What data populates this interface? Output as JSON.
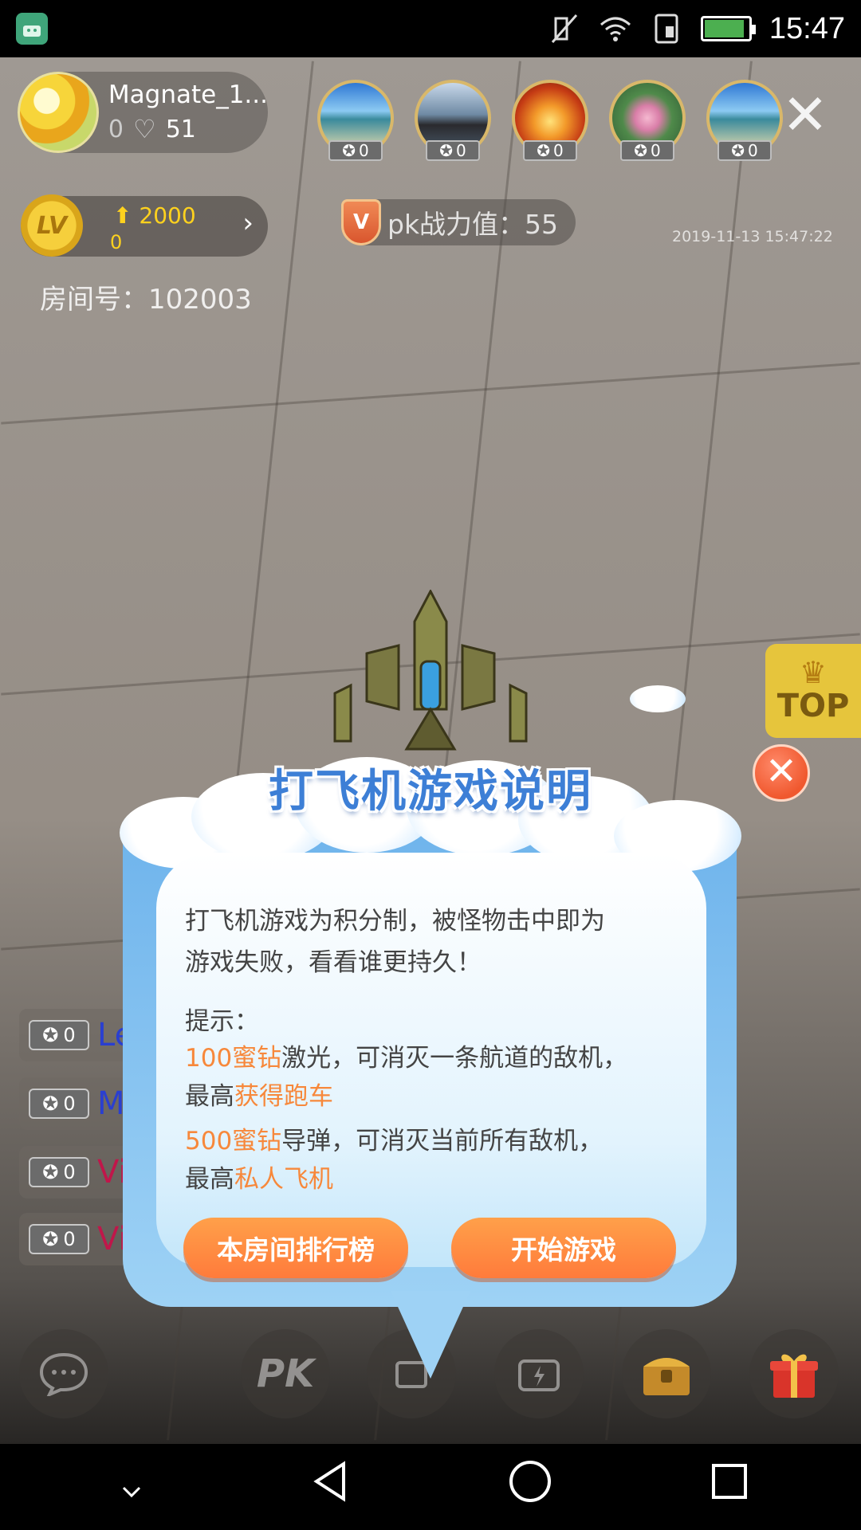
{
  "status_bar": {
    "time": "15:47",
    "battery_level": 0.85,
    "icons": [
      "android-icon",
      "mute-icon",
      "wifi-icon",
      "sim-icon",
      "battery-icon"
    ]
  },
  "host": {
    "name": "Magnate_1...",
    "hearts": "0",
    "fans": "51"
  },
  "viewers": [
    {
      "stars": "0"
    },
    {
      "stars": "0"
    },
    {
      "stars": "0"
    },
    {
      "stars": "0"
    },
    {
      "stars": "0"
    }
  ],
  "close_symbol": "✕",
  "level": {
    "badge": "LV",
    "up_value": "2000",
    "current": "0",
    "arrow": "›"
  },
  "pk": {
    "label": "pk战力值：55",
    "shield_letter": "V"
  },
  "timestamp": "2019-11-13 15:47:22",
  "room_number": "房间号：102003",
  "top_button": {
    "label": "TOP"
  },
  "chat_list": [
    {
      "stars": "0",
      "name": "Le",
      "color": "#2a3fd0"
    },
    {
      "stars": "0",
      "name": "M",
      "color": "#2a3fd0"
    },
    {
      "stars": "0",
      "name": "Vi",
      "color": "#c0164a"
    },
    {
      "stars": "0",
      "name": "Vi",
      "color": "#c0164a"
    }
  ],
  "toolbar": {
    "pk_label": "PK"
  },
  "dialog": {
    "title": "打飞机游戏说明",
    "close": "✕",
    "line1": "打飞机游戏为积分制，被怪物击中即为",
    "line2": "游戏失败，看看谁更持久！",
    "tip_label": "提示：",
    "tip1_hl": "100蜜钻",
    "tip1_rest": "激光，可消灭一条航道的敌机，",
    "tip1_prefix2": "最高",
    "tip1_reward": "获得跑车",
    "tip2_hl": "500蜜钻",
    "tip2_rest": "导弹，可消灭当前所有敌机，",
    "tip2_prefix2": "最高",
    "tip2_reward": "私人飞机",
    "ranking_button": "本房间排行榜",
    "start_button": "开始游戏",
    "highlight_color": "#f7883b",
    "button_color": "#ff8a40"
  }
}
